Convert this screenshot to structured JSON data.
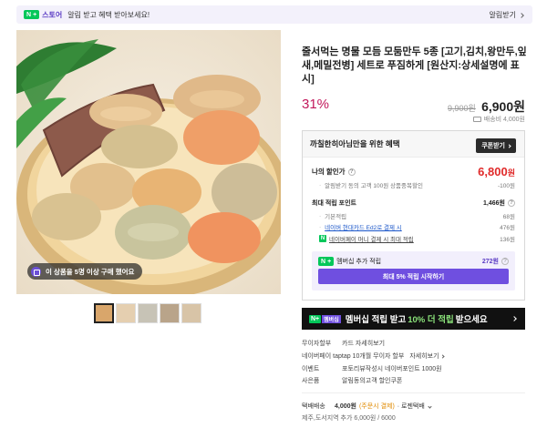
{
  "banner": {
    "brand_badge": "N",
    "store_label": "스토어",
    "message": "알림 받고 혜택 받아보세요!",
    "action": "알림받기"
  },
  "gallery": {
    "badge_text": "이 상품을 5명 이상 구매 했어요",
    "thumbnail_count": 5
  },
  "product": {
    "title": "줄서먹는 명물 모듬 모둠만두 5종 [고기,김치,왕만두,잎새,메밀전병] 세트로 푸짐하게 [원산지:상세설명에 표시]",
    "discount_rate": "31%",
    "original_price": "9,900원",
    "sale_price": "6,900원",
    "shipping_fee_line": "배송비 4,000원"
  },
  "benefit": {
    "title": "까칠한히아님만을 위한 혜택",
    "coupon_button": "쿠폰받기",
    "my_discount_label": "나의 할인가",
    "my_discount_price": "6,800",
    "my_discount_unit": "원",
    "discount_note": "알림받기 동의 고객 100원 상품중복할인",
    "discount_note_value": "-100원",
    "max_points_label": "최대 적립 포인트",
    "max_points_value": "1,466원",
    "basic_points_label": "기본적립",
    "basic_points_value": "68원",
    "card_points_label": "네이버 현대카드 Ed2로 결제 시",
    "card_points_value": "476원",
    "npay_points_label": "네이버페이 머니 결제 시 최대 적립",
    "npay_points_value": "136원",
    "membership_label": "멤버십 추가 적립",
    "membership_value": "272원",
    "membership_button": "최대 5% 적립 시작하기"
  },
  "promo": {
    "tag_n": "N+",
    "tag_member": "멤버십",
    "text_before": "멤버십 적립 받고",
    "highlight": "10% 더 적립",
    "text_after": "받으세요"
  },
  "info_rows": [
    {
      "key": "무이자할부",
      "value": "카드 자세히보기",
      "more": ""
    },
    {
      "key": "네이버페이 taptap 10개월 무이자 할부",
      "value": "",
      "more": "자세히보기"
    },
    {
      "key": "이벤트",
      "value": "포토리뷰작성시 네이버포인트 1000원",
      "more": ""
    },
    {
      "key": "사은품",
      "value": "알림동의고객 할인쿠폰",
      "more": ""
    }
  ],
  "shipping": {
    "label": "택배배송",
    "fee": "4,000원",
    "condition": "(주문시 결제)",
    "carrier": "· 로젠택배",
    "jeju": "제주,도서지역 추가 6,000원 / 6000"
  },
  "colors": {
    "accent_purple": "#6f4fe0",
    "sale_red": "#e02a2a",
    "discount_magenta": "#c2185b",
    "naver_green": "#03c75a"
  }
}
